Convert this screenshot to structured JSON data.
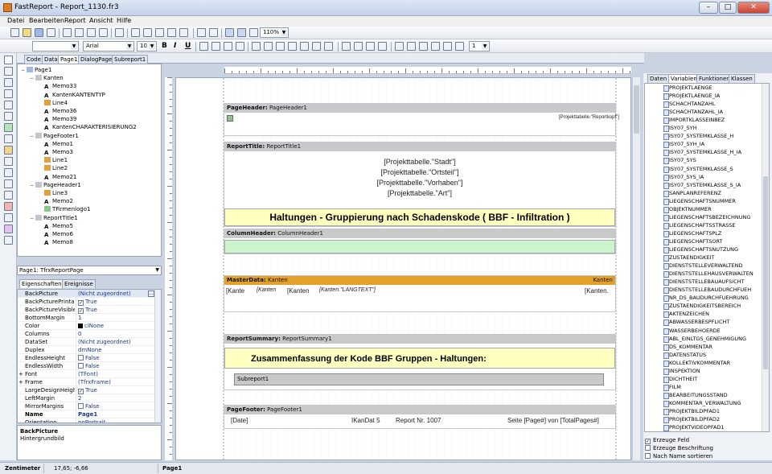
{
  "window": {
    "title": "FastReport - Report_1130.fr3",
    "min_label": "–",
    "max_label": "□",
    "close_label": "✕"
  },
  "menu": [
    "Datei",
    "Bearbeiten",
    "Report",
    "Ansicht",
    "Hilfe"
  ],
  "toolbar": {
    "font_name": "Arial",
    "font_size": "10",
    "zoom": "110%",
    "bold": "B",
    "italic": "I",
    "underline": "U",
    "line_width": "1"
  },
  "page_tabs": [
    "Code",
    "Data",
    "Page1",
    "DialogPage1",
    "Subreport1"
  ],
  "tree": [
    {
      "label": "Page1",
      "level": 1,
      "icon": "page-icon",
      "toggle": "−"
    },
    {
      "label": "Kanten",
      "level": 2,
      "icon": "band-icon",
      "toggle": "−"
    },
    {
      "label": "Memo33",
      "level": 3,
      "icon": "text-icon"
    },
    {
      "label": "KantenKANTENTYP",
      "level": 3,
      "icon": "text-icon"
    },
    {
      "label": "Line4",
      "level": 3,
      "icon": "line-icon"
    },
    {
      "label": "Memo36",
      "level": 3,
      "icon": "text-icon"
    },
    {
      "label": "Memo39",
      "level": 3,
      "icon": "text-icon"
    },
    {
      "label": "KantenCHARAKTERISIERUNG2",
      "level": 3,
      "icon": "text-icon"
    },
    {
      "label": "PageFooter1",
      "level": 2,
      "icon": "band-icon",
      "toggle": "−"
    },
    {
      "label": "Memo1",
      "level": 3,
      "icon": "text-icon"
    },
    {
      "label": "Memo3",
      "level": 3,
      "icon": "text-icon"
    },
    {
      "label": "Line1",
      "level": 3,
      "icon": "line-icon"
    },
    {
      "label": "Line2",
      "level": 3,
      "icon": "line-icon"
    },
    {
      "label": "Memo21",
      "level": 3,
      "icon": "text-icon"
    },
    {
      "label": "PageHeader1",
      "level": 2,
      "icon": "band-icon",
      "toggle": "−"
    },
    {
      "label": "Line3",
      "level": 3,
      "icon": "line-icon"
    },
    {
      "label": "Memo2",
      "level": 3,
      "icon": "text-icon"
    },
    {
      "label": "TFirmenlogo1",
      "level": 3,
      "icon": "picture-icon"
    },
    {
      "label": "ReportTitle1",
      "level": 2,
      "icon": "band-icon",
      "toggle": "−"
    },
    {
      "label": "Memo5",
      "level": 3,
      "icon": "text-icon"
    },
    {
      "label": "Memo6",
      "level": 3,
      "icon": "text-icon"
    },
    {
      "label": "Memo8",
      "level": 3,
      "icon": "text-icon"
    }
  ],
  "object_selector": "Page1: TfrxReportPage",
  "prop_tabs": [
    "Eigenschaften",
    "Ereignisse"
  ],
  "properties": [
    {
      "name": "BackPicture",
      "value": "(Nicht zugeordnet)",
      "selected": true
    },
    {
      "name": "BackPicturePrintable",
      "value": "True",
      "check": true
    },
    {
      "name": "BackPictureVisible",
      "value": "True",
      "check": true
    },
    {
      "name": "BottomMargin",
      "value": "1"
    },
    {
      "name": "Color",
      "value": "clNone",
      "swatch": "#000000"
    },
    {
      "name": "Columns",
      "value": "0"
    },
    {
      "name": "DataSet",
      "value": "(Nicht zugeordnet)"
    },
    {
      "name": "Duplex",
      "value": "dmNone"
    },
    {
      "name": "EndlessHeight",
      "value": "False",
      "check": false
    },
    {
      "name": "EndlessWidth",
      "value": "False",
      "check": false
    },
    {
      "name": "Font",
      "value": "(TFont)",
      "expand": "+"
    },
    {
      "name": "Frame",
      "value": "(TfrxFrame)",
      "expand": "+"
    },
    {
      "name": "LargeDesignHeight",
      "value": "True",
      "check": true
    },
    {
      "name": "LeftMargin",
      "value": "2"
    },
    {
      "name": "MirrorMargins",
      "value": "False",
      "check": false
    },
    {
      "name": "Name",
      "value": "Page1",
      "bold": true
    },
    {
      "name": "Orientation",
      "value": "poPortrait"
    }
  ],
  "prop_desc": {
    "title": "BackPicture",
    "text": "Hintergrundbild"
  },
  "bands": {
    "page_header": {
      "label": "PageHeader:",
      "name": "PageHeader1",
      "memo": "[Projekttabelle.\"Reportkopf\"]"
    },
    "report_title": {
      "label": "ReportTitle:",
      "name": "ReportTitle1",
      "lines": [
        "[Projekttabelle.\"Stadt\"]",
        "[Projekttabelle.\"Ortsteil\"]",
        "[Projekttabelle.\"Vorhaben\"]",
        "[Projekttabelle.\"Art\"]"
      ],
      "heading": "Haltungen - Gruppierung nach Schadenskode ( BBF - Infiltration )"
    },
    "column_header": {
      "label": "ColumnHeader:",
      "name": "ColumnHeader1"
    },
    "master_data": {
      "label": "MasterData:",
      "name": "Kanten",
      "dataset": "Kanten",
      "memos": [
        "[Kante",
        "[Kanten",
        "[Kanten",
        "[Kanten.\"LANGTEXT\"]",
        "[Kanten."
      ]
    },
    "report_summary": {
      "label": "ReportSummary:",
      "name": "ReportSummary1",
      "heading": "Zusammenfassung der Kode BBF Gruppen - Haltungen:",
      "subreport": "Subreport1"
    },
    "page_footer": {
      "label": "PageFooter:",
      "name": "PageFooter1",
      "date": "[Date]",
      "ikandat": "IKanDat 5",
      "report_no": "Report Nr. 1007",
      "page": "Seite [Page#] von [TotalPages#]"
    }
  },
  "right_tabs": [
    "Daten",
    "Variablen",
    "Funktionen",
    "Klassen"
  ],
  "variables": [
    "PROJEKTLAENGE",
    "PROJEKTLAENGE_IA",
    "SCHACHTANZAHL",
    "SCHACHTANZAHL_IA",
    "IMPORTKLASSEINBEZ",
    "ISY07_SYH",
    "ISY07_SYSTEMKLASSE_H",
    "ISY07_SYH_IA",
    "ISY07_SYSTEMKLASSE_H_IA",
    "ISY07_SYS",
    "ISY07_SYSTEMKLASSE_S",
    "ISY07_SYS_IA",
    "ISY07_SYSTEMKLASSE_S_IA",
    "SANPLANREFERENZ",
    "LIEGENSCHAFTSNUMMER",
    "OBJEKTNUMMER",
    "LIEGENSCHAFTSBEZEICHNUNG",
    "LIEGENSCHAFTSSTRASSE",
    "LIEGENSCHAFTSPLZ",
    "LIEGENSCHAFTSORT",
    "LIEGENSCHAFTSNUTZUNG",
    "ZUSTAENDIGKEIT",
    "DIENSTSTELLEVERWALTEND",
    "DIENSTSTELLEHAUSVERWALTEN",
    "DIENSTSTELLEBAUAUFSICHT",
    "DIENSTSTELLEBAUDURCHFUEH",
    "NR_DS_BAUDURCHFUEHRUNG",
    "ZUSTAENDIGKEITSBEREICH",
    "AKTENZEICHEN",
    "ABWASSERBESPFLICHT",
    "WASSERBEHOERDE",
    "ABL_EINLTGS_GENEHMIGUNG",
    "DS_KOMMENTAR",
    "DATENSTATUS",
    "KOLLEKTIVKOMMENTAR",
    "INSPEKTION",
    "DICHTHEIT",
    "FILM",
    "BEARBEITUNGSSTAND",
    "KOMMENTAR_VERWALTUNG",
    "PROJEKTBILDPFAD1",
    "PROJEKTBILDPFAD2",
    "PROJEKTVIDEOPFAD1"
  ],
  "right_checks": [
    {
      "label": "Erzeuge Feld",
      "checked": true
    },
    {
      "label": "Erzeuge Beschriftung",
      "checked": false
    },
    {
      "label": "Nach Name sortieren",
      "checked": false
    }
  ],
  "status": {
    "units": "Zentimeter",
    "coords": "17,65; -6,66",
    "page": "Page1"
  },
  "colors": {
    "master_band": "#e5a02c",
    "yellow_memo": "#ffffc0",
    "column_memo": "#cdf5cd"
  }
}
